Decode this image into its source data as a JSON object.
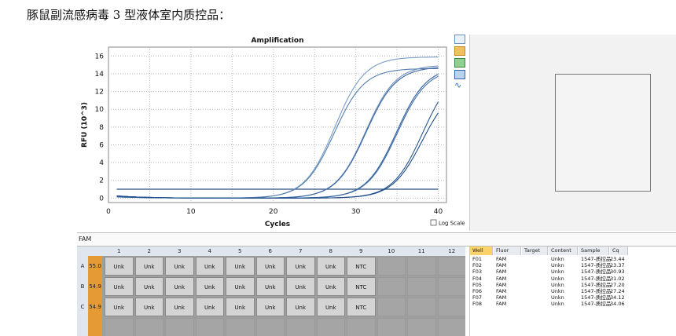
{
  "page": {
    "title": "豚鼠副流感病毒 3 型液体室内质控品："
  },
  "chart_data": {
    "type": "line",
    "title": "Amplification",
    "xlabel": "Cycles",
    "ylabel": "RFU (10^3)",
    "xlim": [
      0,
      41
    ],
    "ylim": [
      -0.5,
      17
    ],
    "xticks": [
      0,
      10,
      20,
      30,
      40
    ],
    "yticks": [
      0,
      2,
      4,
      6,
      8,
      10,
      12,
      14,
      16
    ],
    "grid": true,
    "log_scale_label": "Log Scale",
    "series": [
      {
        "cq": 23.44,
        "max": 15.9
      },
      {
        "cq": 23.37,
        "max": 14.6
      },
      {
        "cq": 30.93,
        "max": 14.8
      },
      {
        "cq": 31.02,
        "max": 14.6
      },
      {
        "cq": 27.2,
        "max": 15.0
      },
      {
        "cq": 27.24,
        "max": 14.8
      },
      {
        "cq": 34.12,
        "max": 14.7
      },
      {
        "cq": 34.06,
        "max": 12.9
      }
    ],
    "threshold": 1.0
  },
  "fluor_bar": {
    "label": "FAM"
  },
  "plate": {
    "columns": [
      "1",
      "2",
      "3",
      "4",
      "5",
      "6",
      "7",
      "8",
      "9",
      "10",
      "11",
      "12"
    ],
    "rows": [
      {
        "row": "A",
        "temp": "55.0",
        "cells": [
          "Unk",
          "Unk",
          "Unk",
          "Unk",
          "Unk",
          "Unk",
          "Unk",
          "Unk",
          "NTC",
          "",
          "",
          ""
        ]
      },
      {
        "row": "B",
        "temp": "54.9",
        "cells": [
          "Unk",
          "Unk",
          "Unk",
          "Unk",
          "Unk",
          "Unk",
          "Unk",
          "Unk",
          "NTC",
          "",
          "",
          ""
        ]
      },
      {
        "row": "C",
        "temp": "54.9",
        "cells": [
          "Unk",
          "Unk",
          "Unk",
          "Unk",
          "Unk",
          "Unk",
          "Unk",
          "Unk",
          "NTC",
          "",
          "",
          ""
        ]
      },
      {
        "row": "",
        "temp": "",
        "cells": [
          "",
          "",
          "",
          "",
          "",
          "",
          "",
          "",
          "",
          "",
          "",
          ""
        ]
      }
    ]
  },
  "well_table": {
    "headers": [
      "Well",
      "Fluor",
      "Target",
      "Content",
      "Sample",
      "Cq"
    ],
    "rows": [
      {
        "well": "F01",
        "fluor": "FAM",
        "target": "",
        "content": "Unkn",
        "sample": "1547-质控品",
        "cq": "23.44"
      },
      {
        "well": "F02",
        "fluor": "FAM",
        "target": "",
        "content": "Unkn",
        "sample": "1547-质控品",
        "cq": "23.37"
      },
      {
        "well": "F03",
        "fluor": "FAM",
        "target": "",
        "content": "Unkn",
        "sample": "1547-质控品",
        "cq": "30.93"
      },
      {
        "well": "F04",
        "fluor": "FAM",
        "target": "",
        "content": "Unkn",
        "sample": "1547-质控品",
        "cq": "31.02"
      },
      {
        "well": "F05",
        "fluor": "FAM",
        "target": "",
        "content": "Unkn",
        "sample": "1547-质控品",
        "cq": "27.20"
      },
      {
        "well": "F06",
        "fluor": "FAM",
        "target": "",
        "content": "Unkn",
        "sample": "1547-质控品",
        "cq": "27.24"
      },
      {
        "well": "F07",
        "fluor": "FAM",
        "target": "",
        "content": "Unkn",
        "sample": "1547-质控品",
        "cq": "34.12"
      },
      {
        "well": "F08",
        "fluor": "FAM",
        "target": "",
        "content": "Unkn",
        "sample": "1547-质控品",
        "cq": "34.06"
      }
    ]
  }
}
